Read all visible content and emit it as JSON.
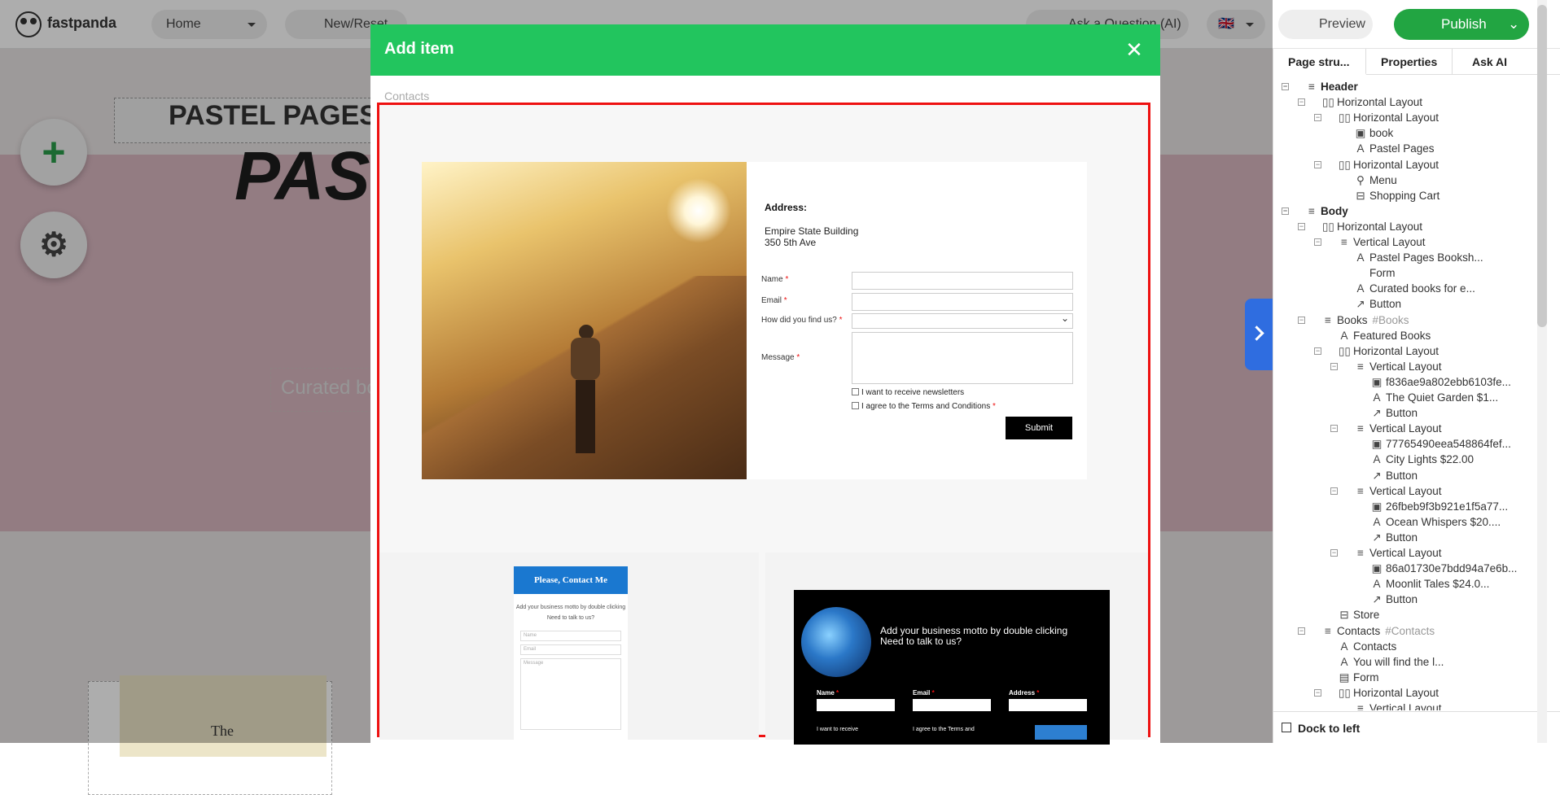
{
  "topbar": {
    "app_name": "fastpanda",
    "page_select": "Home",
    "new_reset": "New/Reset",
    "ask_ai": "Ask a Question (AI)",
    "preview": "Preview",
    "publish": "Publish"
  },
  "canvas": {
    "brand": "PASTEL PAGES",
    "hero_title": "PAS",
    "curated": "Curated bo"
  },
  "modal": {
    "title": "Add item",
    "crumb": "Contacts",
    "tpl1": {
      "address_label": "Address:",
      "address_line1": "Empire State Building",
      "address_line2": "350 5th Ave",
      "fields": [
        {
          "label": "Name"
        },
        {
          "label": "Email"
        },
        {
          "label": "How did you find us?"
        },
        {
          "label": "Message"
        }
      ],
      "newsletter": "I want to receive newsletters",
      "terms": "I agree to the Terms and Conditions",
      "submit": "Submit"
    },
    "tpl2": {
      "heading": "Please, Contact Me",
      "motto": "Add your business motto by double clicking",
      "talk": "Need to talk to us?",
      "name_ph": "Name",
      "email_ph": "Email",
      "message_ph": "Message"
    },
    "tpl3": {
      "motto": "Add your business motto by double clicking",
      "talk": "Need to talk to us?",
      "name": "Name",
      "email": "Email",
      "address": "Address",
      "newsletter": "I want to receive",
      "terms": "I agree to the Terms and"
    }
  },
  "panel": {
    "tabs": [
      "Page stru...",
      "Properties",
      "Ask AI"
    ],
    "tree": [
      {
        "label": "Header",
        "icon": "≡",
        "bold": true
      },
      {
        "label": "Horizontal Layout",
        "icon": "▯▯"
      },
      {
        "label": "Horizontal Layout",
        "icon": "▯▯"
      },
      {
        "label": "book",
        "icon": "▣"
      },
      {
        "label": "Pastel Pages",
        "icon": "A"
      },
      {
        "label": "Horizontal Layout",
        "icon": "▯▯"
      },
      {
        "label": "Menu",
        "icon": "⚲"
      },
      {
        "label": "Shopping Cart",
        "icon": "⊟"
      },
      {
        "label": "Body",
        "icon": "≡",
        "bold": true
      },
      {
        "label": "Horizontal Layout",
        "icon": "▯▯"
      },
      {
        "label": "Vertical Layout",
        "icon": "≡"
      },
      {
        "label": "Pastel Pages Booksh...",
        "icon": "A"
      },
      {
        "label": "Form",
        "icon": ""
      },
      {
        "label": "Curated books for e...",
        "icon": "A"
      },
      {
        "label": "Button",
        "icon": "↗"
      },
      {
        "label": "Books",
        "icon": "≡",
        "anchor": "#Books"
      },
      {
        "label": "Featured Books",
        "icon": "A"
      },
      {
        "label": "Horizontal Layout",
        "icon": "▯▯"
      },
      {
        "label": "Vertical Layout",
        "icon": "≡"
      },
      {
        "label": "f836ae9a802ebb6103fe...",
        "icon": "▣"
      },
      {
        "label": "The Quiet Garden $1...",
        "icon": "A"
      },
      {
        "label": "Button",
        "icon": "↗"
      },
      {
        "label": "Vertical Layout",
        "icon": "≡"
      },
      {
        "label": "77765490eea548864fef...",
        "icon": "▣"
      },
      {
        "label": "City Lights $22.00",
        "icon": "A"
      },
      {
        "label": "Button",
        "icon": "↗"
      },
      {
        "label": "Vertical Layout",
        "icon": "≡"
      },
      {
        "label": "26fbeb9f3b921e1f5a77...",
        "icon": "▣"
      },
      {
        "label": "Ocean Whispers $20....",
        "icon": "A"
      },
      {
        "label": "Button",
        "icon": "↗"
      },
      {
        "label": "Vertical Layout",
        "icon": "≡"
      },
      {
        "label": "86a01730e7bdd94a7e6b...",
        "icon": "▣"
      },
      {
        "label": "Moonlit Tales $24.0...",
        "icon": "A"
      },
      {
        "label": "Button",
        "icon": "↗"
      },
      {
        "label": "Store",
        "icon": "⊟"
      },
      {
        "label": "Contacts",
        "icon": "≡",
        "anchor": "#Contacts"
      },
      {
        "label": "Contacts",
        "icon": "A"
      },
      {
        "label": "You will find the l...",
        "icon": "A"
      },
      {
        "label": "Form",
        "icon": "▤"
      },
      {
        "label": "Horizontal Layout",
        "icon": "▯▯"
      },
      {
        "label": "Vertical Layout",
        "icon": "≡"
      }
    ],
    "dock": "Dock to left"
  },
  "colors": {
    "accent_green": "#22c55e",
    "publish_green": "#22a542",
    "highlight_red": "#e11111",
    "toggle_blue": "#2f6de0"
  }
}
